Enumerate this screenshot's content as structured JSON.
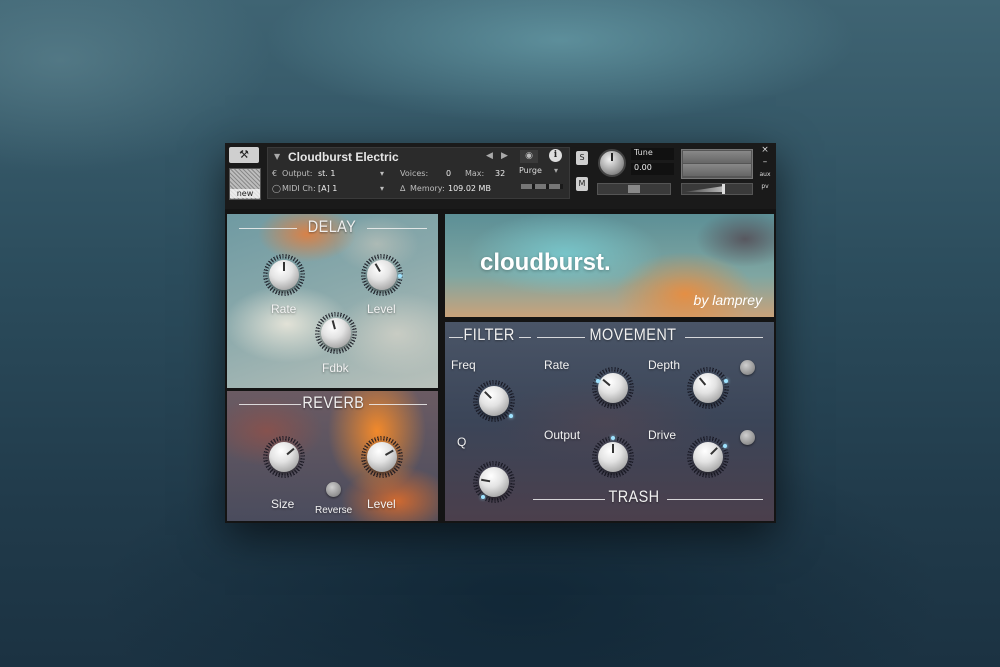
{
  "header": {
    "instrument_name": "Cloudburst Electric",
    "output_label": "Output:",
    "output_value": "st. 1",
    "midi_label": "MIDI Ch:",
    "midi_value": "[A]  1",
    "voices_label": "Voices:",
    "voices_value": "0",
    "max_label": "Max:",
    "max_value": "32",
    "memory_label": "Memory:",
    "memory_value": "109.02 MB",
    "purge_label": "Purge",
    "solo_label": "S",
    "mute_label": "M",
    "tune_label": "Tune",
    "tune_value": "0.00",
    "new_label": "new",
    "aux_label": "aux",
    "pv_label": "pv",
    "close_glyph": "×",
    "minimize_glyph": "–"
  },
  "delay": {
    "title": "DELAY",
    "rate_label": "Rate",
    "level_label": "Level",
    "fdbk_label": "Fdbk"
  },
  "reverb": {
    "title": "REVERB",
    "size_label": "Size",
    "reverse_label": "Reverse",
    "level_label": "Level"
  },
  "banner": {
    "brand": "cloudburst.",
    "byline": "by lamprey"
  },
  "filter": {
    "title": "FILTER",
    "freq_label": "Freq",
    "q_label": "Q"
  },
  "movement": {
    "title": "MOVEMENT",
    "rate_label": "Rate",
    "depth_label": "Depth"
  },
  "trash": {
    "title": "TRASH",
    "output_label": "Output",
    "drive_label": "Drive"
  },
  "icons": [
    "wrench-icon",
    "camera-icon",
    "info-icon",
    "dropdown-arrow-icon",
    "prev-arrow-icon",
    "next-arrow-icon",
    "close-icon",
    "minimize-icon"
  ]
}
